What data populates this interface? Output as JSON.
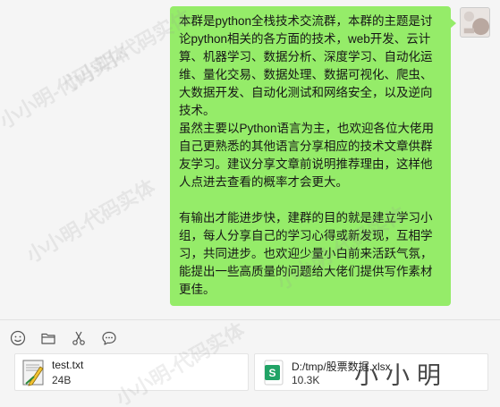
{
  "chat": {
    "message": {
      "paragraphs": [
        "本群是python全栈技术交流群，本群的主题是讨论python相关的各方面的技术，web开发、云计算、机器学习、数据分析、深度学习、自动化运维、量化交易、数据处理、数据可视化、爬虫、大数据开发、自动化测试和网络安全，以及逆向技术。",
        "虽然主要以Python语言为主，也欢迎各位大佬用自己更熟悉的其他语言分享相应的技术文章供群友学习。建议分享文章前说明推荐理由，这样他人点进去查看的概率才会更大。",
        "有输出才能进步快，建群的目的就是建立学习小组，每人分享自己的学习心得或新发现，互相学习，共同进步。也欢迎少量小白前来活跃气氛，能提出一些高质量的问题给大佬们提供写作素材更佳。"
      ]
    }
  },
  "toolbar": {
    "icons": [
      "emoji-icon",
      "folder-icon",
      "scissors-icon",
      "chat-history-icon"
    ]
  },
  "attachments": [
    {
      "name": "test.txt",
      "size": "24B",
      "icon": "text-file-icon"
    },
    {
      "name": "D:/tmp/股票数据.xlsx",
      "size": "10.3K",
      "icon": "spreadsheet-file-icon"
    }
  ],
  "brand_text": "小小明",
  "watermark_text": "小小明-代码实体",
  "colors": {
    "bubble": "#95ec69",
    "background": "#f5f5f5",
    "spreadsheet_icon": "#21a366"
  }
}
